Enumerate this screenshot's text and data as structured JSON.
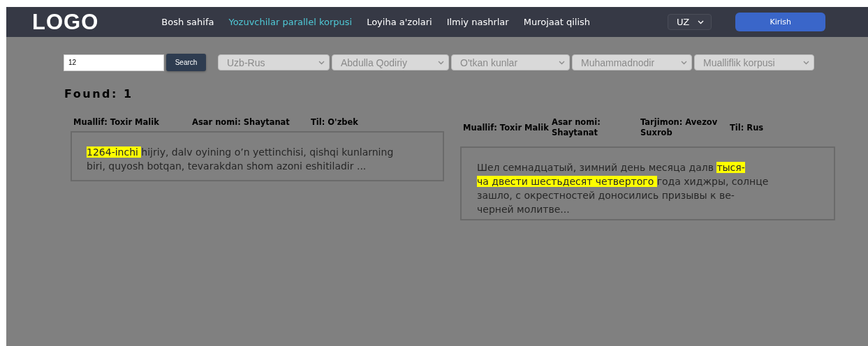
{
  "header": {
    "logo": "LOGO",
    "nav": [
      {
        "label": "Bosh sahifa",
        "selected": false
      },
      {
        "label": "Yozuvchilar parallel korpusi",
        "selected": true
      },
      {
        "label": "Loyiha a'zolari",
        "selected": false
      },
      {
        "label": "Ilmiy nashrlar",
        "selected": false
      },
      {
        "label": "Murojaat qilish",
        "selected": false
      }
    ],
    "language": "UZ",
    "login_button": "Kirish"
  },
  "search": {
    "value": "12",
    "button": "Search"
  },
  "filters": [
    "Uzb-Rus",
    "Abdulla Qodiriy",
    "O'tkan kunlar",
    "Muhammadnodir",
    "Mualliflik korpusi"
  ],
  "found": "Found: 1",
  "results": [
    {
      "meta": [
        "Muallif: Toxir Malik",
        "Asar nomi: Shaytanat",
        "Til: O'zbek"
      ],
      "lines": [
        [
          {
            "text": "1264-inchi ",
            "highlight": true
          },
          {
            "text": "hijriy, dalv oyining o’n yettinchisi, qishqi kunlarning",
            "highlight": false
          }
        ],
        [
          {
            "text": "biri, quyosh botqan, tevarakdan shom azoni eshitiladir ...",
            "highlight": false
          }
        ]
      ]
    },
    {
      "meta": [
        "Muallif: Toxir Malik",
        "Asar nomi: Shaytanat",
        "Tarjimon: Avezov Suxrob",
        "Til: Rus"
      ],
      "lines": [
        [
          {
            "text": "Шел семнадцатый, зимний день месяца далв ",
            "highlight": false
          },
          {
            "text": "тыся-",
            "highlight": true
          }
        ],
        [
          {
            "text": "ча двести шестьдесят четвертого ",
            "highlight": true
          },
          {
            "text": "года хиджры, солнце",
            "highlight": false
          }
        ],
        [
          {
            "text": "зашло, с окрестностей доносились призывы к ве-",
            "highlight": false
          }
        ],
        [
          {
            "text": "черней молитве...",
            "highlight": false
          }
        ]
      ]
    }
  ]
}
